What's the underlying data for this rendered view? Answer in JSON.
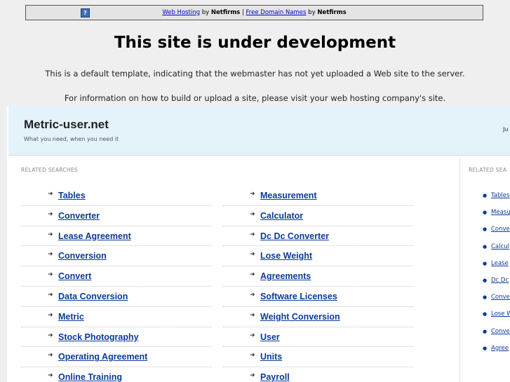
{
  "topbar": {
    "link1": "Web Hosting",
    "by1": " by ",
    "brand1": "Netfirms",
    "sep": " | ",
    "link2": "Free Domain Names",
    "by2": " by ",
    "brand2": "Netfirms",
    "icon": "?"
  },
  "notice": {
    "headline": "This site is under development",
    "line1": "This is a default template, indicating that the webmaster has not yet uploaded a Web site to the server.",
    "line2": "For information on how to build or upload a site, please visit your web hosting company's site."
  },
  "site": {
    "title": "Metric-user.net",
    "tagline": "What you need, when you need it",
    "right_text": "Ju"
  },
  "related_label": "RELATED SEARCHES",
  "related_label_right": "RELATED SEA",
  "searches_left": [
    "Tables",
    "Converter",
    "Lease Agreement",
    "Conversion",
    "Convert",
    "Data Conversion",
    "Metric",
    "Stock Photography",
    "Operating Agreement",
    "Online Training"
  ],
  "searches_right": [
    "Measurement",
    "Calculator",
    "Dc Dc Converter",
    "Lose Weight",
    "Agreements",
    "Software Licenses",
    "Weight Conversion",
    "User",
    "Units",
    "Payroll"
  ],
  "sidebar_items": [
    "Tables",
    "Measu",
    "Conve",
    "Calcul",
    "Lease",
    "Dc Dc",
    "Conve",
    "Lose W",
    "Conve",
    "Agree"
  ],
  "arrow_glyph": "➜",
  "dot_glyph": "●",
  "colors": {
    "link": "#0b3a9a",
    "header_bg": "#e3f3f9",
    "page_bg": "#efefef"
  }
}
